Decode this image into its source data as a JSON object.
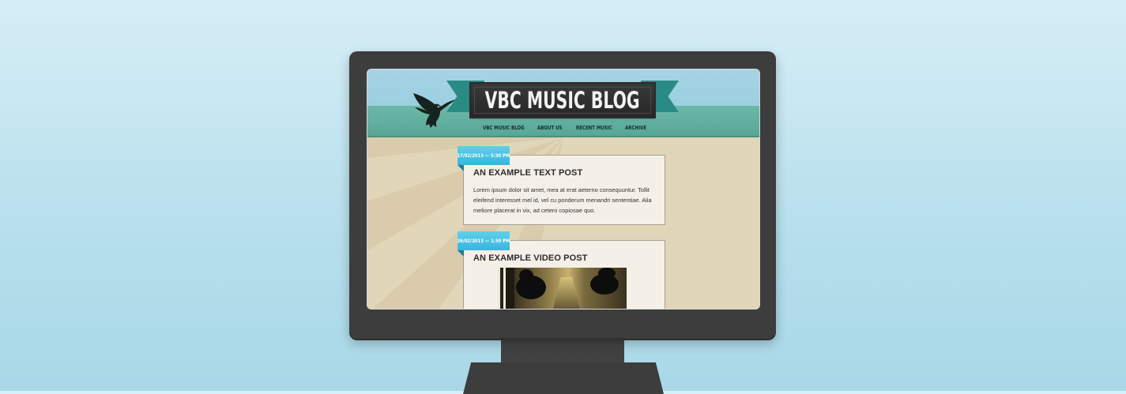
{
  "site": {
    "title": "VBC MUSIC BLOG",
    "nav": [
      "VBC MUSIC BLOG",
      "ABOUT US",
      "RECENT MUSIC",
      "ARCHIVE"
    ]
  },
  "posts": [
    {
      "date": "17/02/2013 — 5:30 PM",
      "title": "AN EXAMPLE TEXT POST",
      "body": "Lorem ipsum dolor sit amet, mea at erat aeterno consequuntur. Tollit eleifend interesset mel id, vel cu ponderum menandri sententiae. Alia meliore placerat in vix, ad cetero copiosae quo."
    },
    {
      "date": "26/02/2013 — 1:30 PM",
      "title": "AN EXAMPLE VIDEO POST"
    }
  ],
  "colors": {
    "background": "#b6dfec",
    "monitor": "#3d3d3d",
    "sky": "#a7d3e5",
    "teal": "#57a696",
    "sand": "#e0d3b6",
    "date_tag": "#38b5db",
    "banner": "#2a2a2a"
  },
  "icons": [
    "eagle-logo"
  ]
}
